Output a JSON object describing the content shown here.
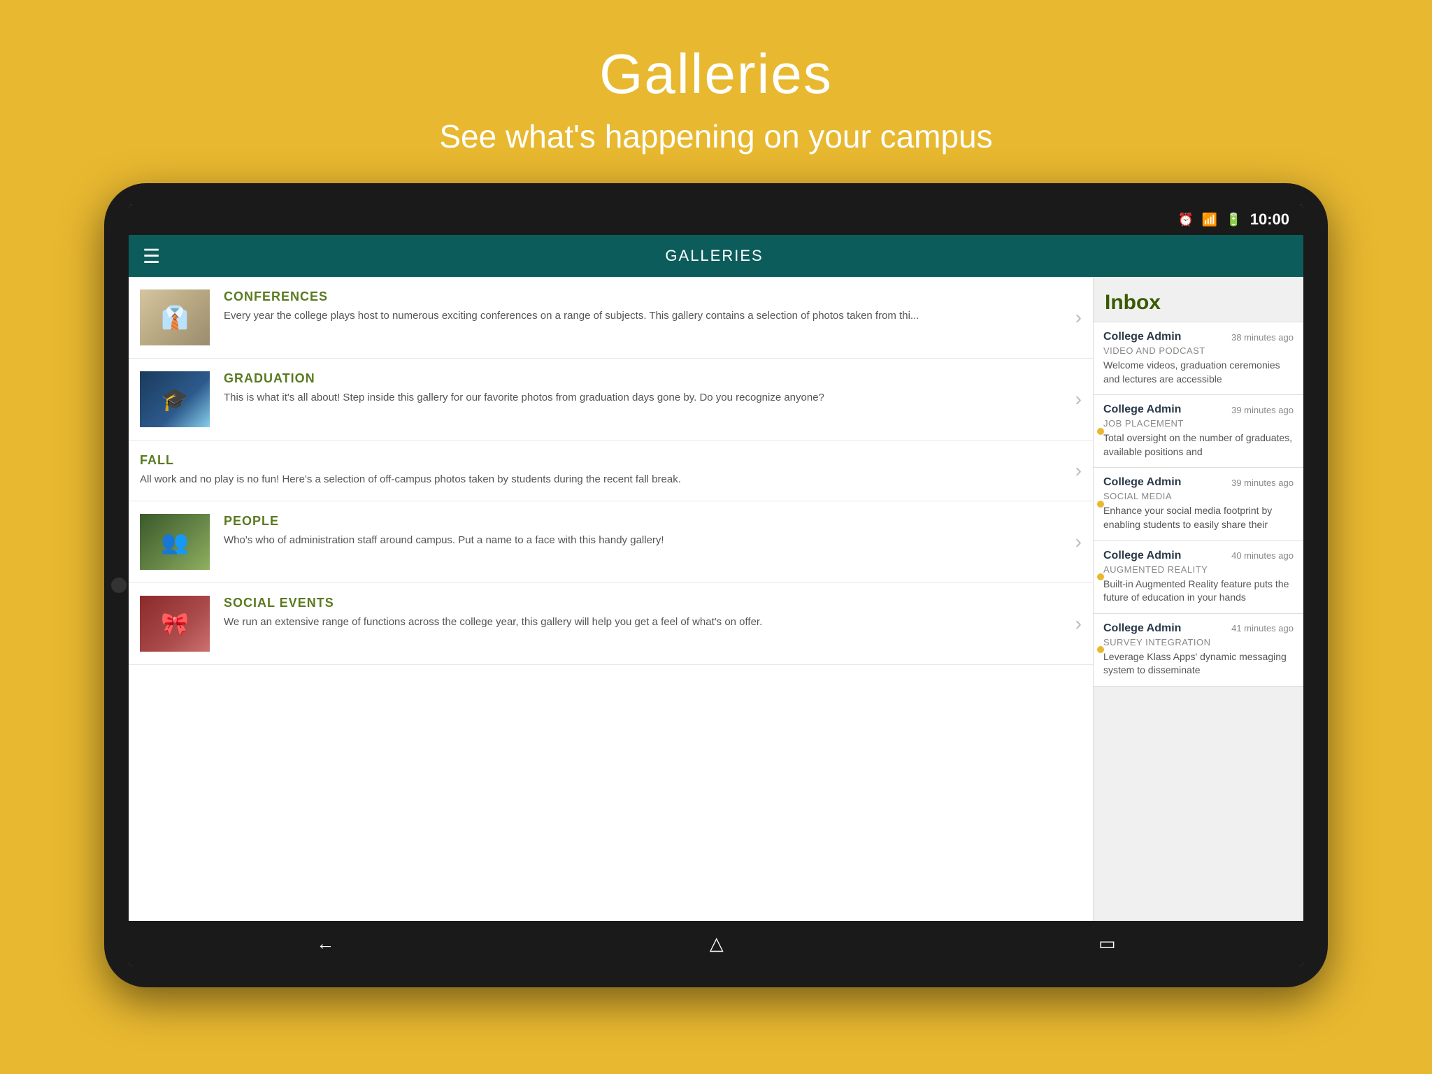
{
  "page": {
    "background_color": "#E8B830",
    "title": "Galleries",
    "subtitle": "See what's happening on your campus"
  },
  "status_bar": {
    "time": "10:00",
    "icons": [
      "alarm",
      "wifi",
      "battery"
    ]
  },
  "app_header": {
    "title": "GALLERIES"
  },
  "gallery_items": [
    {
      "id": "conferences",
      "name": "CONFERENCES",
      "description": "Every year the college plays host to numerous exciting conferences on a range of subjects.  This gallery contains a selection of photos taken from thi...",
      "has_thumb": true,
      "thumb_type": "conferences"
    },
    {
      "id": "graduation",
      "name": "GRADUATION",
      "description": "This is what it's all about!  Step inside this gallery for our favorite photos from graduation days gone by.  Do you recognize anyone?",
      "has_thumb": true,
      "thumb_type": "graduation"
    },
    {
      "id": "fall",
      "name": "FALL",
      "description": "All work and no play is no fun!  Here's a selection of off-campus photos taken by students during the recent fall break.",
      "has_thumb": false,
      "thumb_type": "none"
    },
    {
      "id": "people",
      "name": "PEOPLE",
      "description": "Who's who of administration staff around campus.  Put a name to a face with this handy gallery!",
      "has_thumb": true,
      "thumb_type": "people"
    },
    {
      "id": "social-events",
      "name": "SOCIAL EVENTS",
      "description": "We run an extensive range of functions across the college year, this gallery will help you get a feel of what's on offer.",
      "has_thumb": true,
      "thumb_type": "social"
    }
  ],
  "inbox": {
    "header": "Inbox",
    "items": [
      {
        "sender": "College Admin",
        "time": "38 minutes ago",
        "subject": "VIDEO AND PODCAST",
        "preview": "Welcome videos, graduation ceremonies and lectures are accessible",
        "unread": false
      },
      {
        "sender": "College Admin",
        "time": "39 minutes ago",
        "subject": "JOB PLACEMENT",
        "preview": "Total oversight on the number of graduates, available positions and",
        "unread": true
      },
      {
        "sender": "College Admin",
        "time": "39 minutes ago",
        "subject": "SOCIAL MEDIA",
        "preview": "Enhance your social media footprint by enabling students to easily share their",
        "unread": true
      },
      {
        "sender": "College Admin",
        "time": "40 minutes ago",
        "subject": "AUGMENTED REALITY",
        "preview": "Built-in Augmented Reality feature puts the future of education in your hands",
        "unread": true
      },
      {
        "sender": "College Admin",
        "time": "41 minutes ago",
        "subject": "SURVEY INTEGRATION",
        "preview": "Leverage Klass Apps' dynamic messaging system to disseminate",
        "unread": true
      }
    ]
  },
  "nav_bar": {
    "back_label": "←",
    "home_label": "⌂",
    "recent_label": "⧉"
  }
}
